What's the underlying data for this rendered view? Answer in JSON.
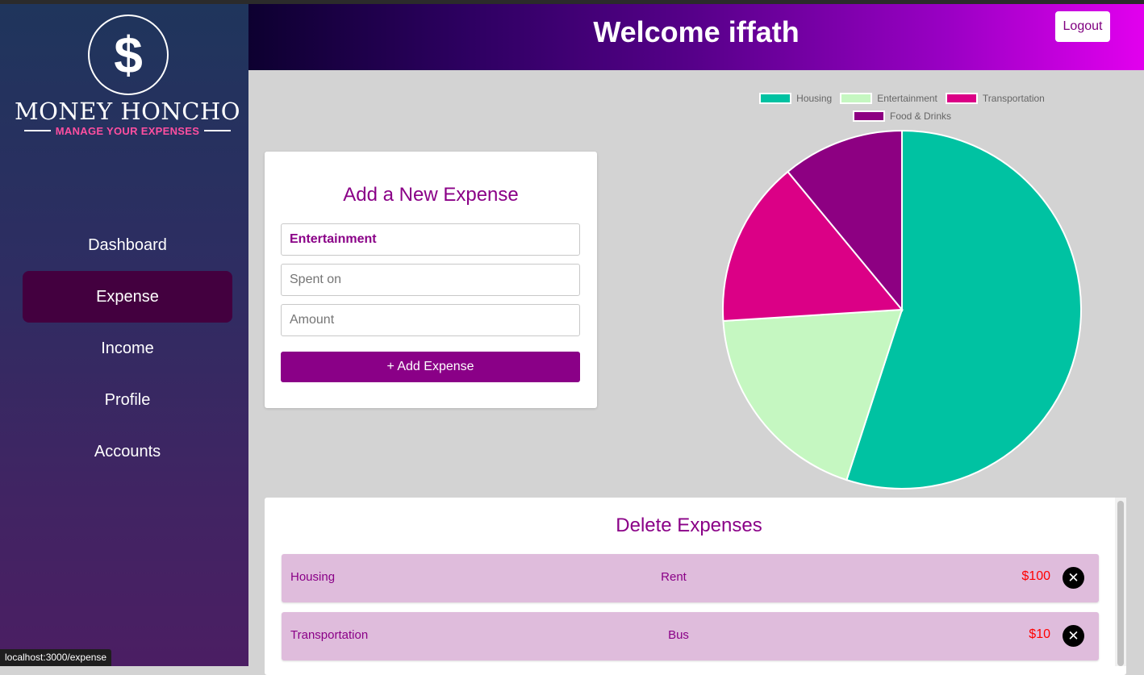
{
  "brand": {
    "logo_symbol": "$",
    "name": "MONEY HONCHO",
    "tagline": "MANAGE YOUR EXPENSES"
  },
  "sidebar": {
    "items": [
      {
        "label": "Dashboard",
        "active": false
      },
      {
        "label": "Expense",
        "active": true
      },
      {
        "label": "Income",
        "active": false
      },
      {
        "label": "Profile",
        "active": false
      },
      {
        "label": "Accounts",
        "active": false
      }
    ]
  },
  "header": {
    "title": "Welcome iffath",
    "logout_label": "Logout"
  },
  "add_form": {
    "title": "Add a New Expense",
    "category_value": "Entertainment",
    "spent_on_placeholder": "Spent on",
    "amount_placeholder": "Amount",
    "submit_label": "+ Add Expense"
  },
  "chart_data": {
    "type": "pie",
    "labels": [
      "Housing",
      "Entertainment",
      "Transportation",
      "Food & Drinks"
    ],
    "values": [
      55,
      19,
      15,
      11
    ],
    "colors": [
      "#00c2a2",
      "#c5f7c1",
      "#db0086",
      "#8d0082"
    ]
  },
  "delete_section": {
    "title": "Delete Expenses",
    "rows": [
      {
        "category": "Housing",
        "description": "Rent",
        "amount": "$100"
      },
      {
        "category": "Transportation",
        "description": "Bus",
        "amount": "$10"
      }
    ]
  },
  "status_bar": {
    "url": "localhost:3000/expense"
  },
  "colors": {
    "accent": "#8a0087",
    "active_nav": "#43003f",
    "amount": "#ff0000",
    "row_bg": "#dfbcdc"
  }
}
